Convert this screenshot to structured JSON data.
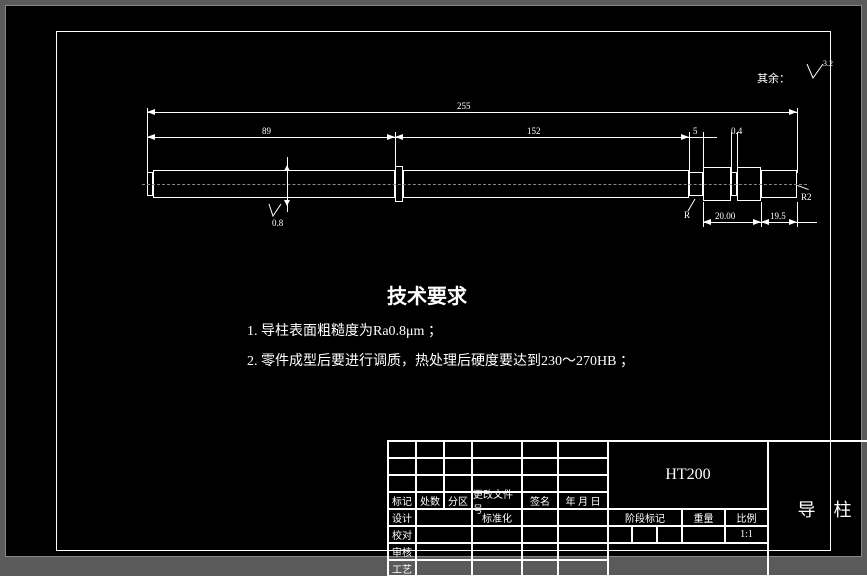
{
  "header": {
    "other_label": "其余：",
    "roughness_main": "3.2"
  },
  "dimensions": {
    "total_len": "255",
    "left_len": "89",
    "right_len": "152",
    "small1": "5",
    "small2": "0.4",
    "dim_20": "20.00",
    "dim_195": "19.5",
    "r_label": "R",
    "r2_label": "R2",
    "roughness_small": "0.8"
  },
  "requirements": {
    "title": "技术要求",
    "line1": "1. 导柱表面粗糙度为Ra0.8μm ；",
    "line2": "2. 零件成型后要进行调质，热处理后硬度要达到230～270HB ；"
  },
  "title_block": {
    "material": "HT200",
    "part_name": "导　柱",
    "rows": {
      "design": "设计",
      "standardize": "标准化",
      "proof": "校对",
      "check": "审核",
      "craft": "工艺"
    },
    "header_row": {
      "mark": "标记",
      "where": "处数",
      "zone": "分区",
      "change_doc": "更改文件号",
      "signature": "签名",
      "date": "年 月 日"
    },
    "stage_mark": "阶段标记",
    "weight": "重量",
    "scale": "比例",
    "scale_val": "1:1"
  }
}
